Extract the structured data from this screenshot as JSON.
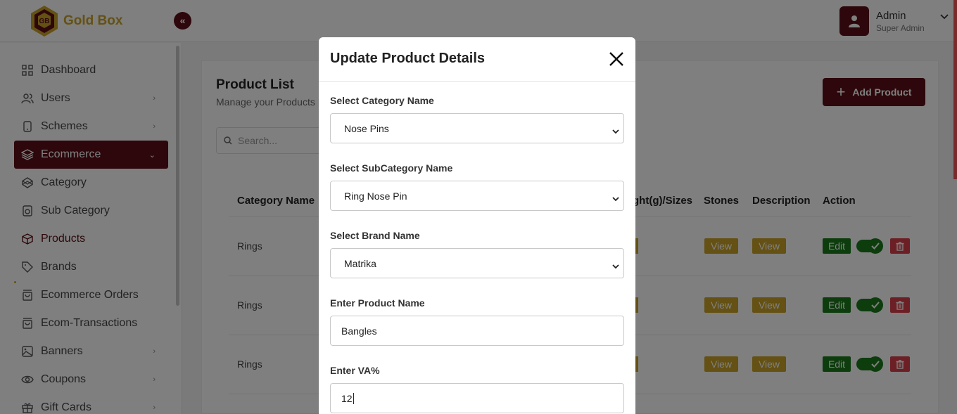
{
  "brand": {
    "name": "Gold Box"
  },
  "user": {
    "name": "Admin",
    "role": "Super Admin"
  },
  "sidebar": {
    "items": [
      {
        "label": "Dashboard",
        "icon": "grid-icon",
        "has_arrow": false
      },
      {
        "label": "Users",
        "icon": "users-icon",
        "has_arrow": true
      },
      {
        "label": "Schemes",
        "icon": "phone-icon",
        "has_arrow": true
      },
      {
        "label": "Ecommerce",
        "icon": "layers-icon",
        "has_arrow": true,
        "active": true
      },
      {
        "label": "Category",
        "icon": "codepen-icon",
        "has_arrow": false
      },
      {
        "label": "Sub Category",
        "icon": "speaker-icon",
        "has_arrow": false
      },
      {
        "label": "Products",
        "icon": "box-icon",
        "has_arrow": false,
        "current": true
      },
      {
        "label": "Brands",
        "icon": "tag-icon",
        "has_arrow": false
      },
      {
        "label": "Ecommerce Orders",
        "icon": "shopping-bag-icon",
        "has_arrow": false
      },
      {
        "label": "Ecom-Transactions",
        "icon": "shopping-bag-icon",
        "has_arrow": false
      },
      {
        "label": "Banners",
        "icon": "image-icon",
        "has_arrow": true
      },
      {
        "label": "Coupons",
        "icon": "eye-icon",
        "has_arrow": true
      },
      {
        "label": "Gift Cards",
        "icon": "gift-icon",
        "has_arrow": true
      }
    ]
  },
  "page": {
    "title": "Product List",
    "subtitle": "Manage your Products",
    "search_placeholder": "Search...",
    "add_button": "Add Product"
  },
  "table": {
    "headers": [
      "Category Name",
      "ght(g)/Sizes",
      "Stones",
      "Description",
      "Action"
    ],
    "rows": [
      {
        "category": "Rings",
        "stones": "View",
        "description": "View",
        "edit": "Edit"
      },
      {
        "category": "Rings",
        "stones": "View",
        "description": "View",
        "edit": "Edit"
      },
      {
        "category": "Rings",
        "stones": "View",
        "description": "View",
        "edit": "Edit"
      }
    ]
  },
  "modal": {
    "title": "Update Product Details",
    "fields": [
      {
        "label": "Select Category Name",
        "value": "Nose Pins",
        "type": "select"
      },
      {
        "label": "Select SubCategory Name",
        "value": "Ring Nose Pin",
        "type": "select"
      },
      {
        "label": "Select Brand Name",
        "value": "Matrika",
        "type": "select"
      },
      {
        "label": "Enter Product Name",
        "value": "Bangles",
        "type": "input"
      },
      {
        "label": "Enter VA%",
        "value": "12",
        "type": "input"
      }
    ]
  },
  "colors": {
    "brand": "#5a0f16",
    "gold": "#c9a227",
    "success": "#1a7a1a",
    "danger": "#d9414b"
  }
}
